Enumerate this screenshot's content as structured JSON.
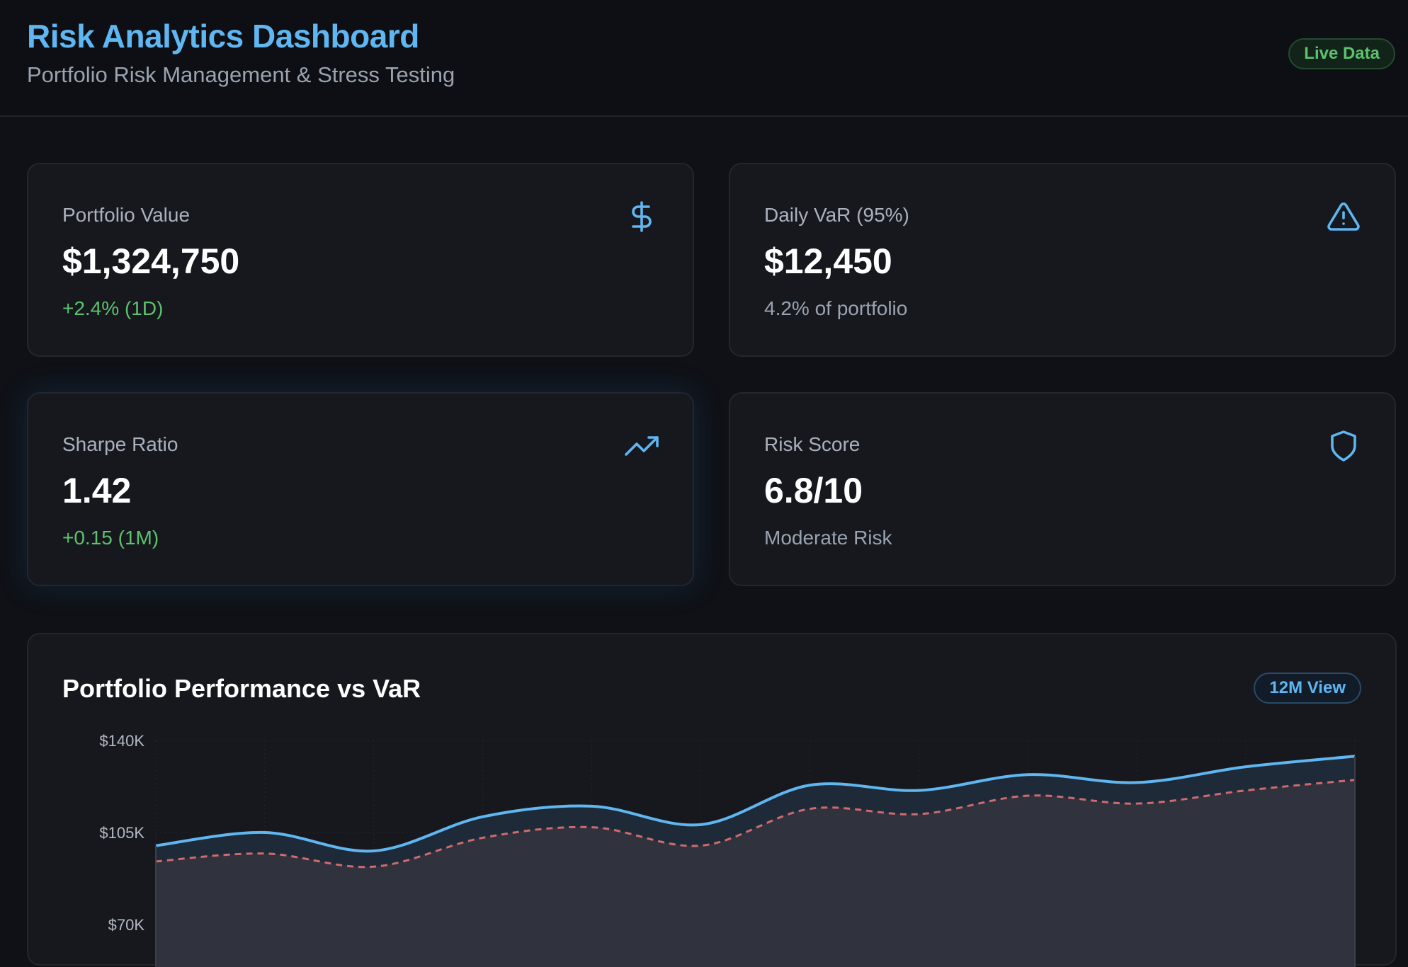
{
  "header": {
    "title": "Risk Analytics Dashboard",
    "subtitle": "Portfolio Risk Management & Stress Testing",
    "live_badge": "Live Data"
  },
  "kpis": [
    {
      "label": "Portfolio Value",
      "value": "$1,324,750",
      "sub": "+2.4% (1D)",
      "sub_color": "#5cc26d",
      "icon": "dollar-icon"
    },
    {
      "label": "Daily VaR (95%)",
      "value": "$12,450",
      "sub": "4.2% of portfolio",
      "sub_color": "#9aa3b0",
      "icon": "warning-icon"
    },
    {
      "label": "Sharpe Ratio",
      "value": "1.42",
      "sub": "+0.15 (1M)",
      "sub_color": "#5cc26d",
      "icon": "trending-up-icon"
    },
    {
      "label": "Risk Score",
      "value": "6.8/10",
      "sub": "Moderate Risk",
      "sub_color": "#9aa3b0",
      "icon": "shield-icon"
    }
  ],
  "colors": {
    "accent": "#5fb6f0",
    "positive": "#5cc26d",
    "var_line": "#d06a6e",
    "background": "#0f1116",
    "card": "#16181e"
  },
  "chart": {
    "title": "Portfolio Performance vs VaR",
    "view_badge": "12M View"
  },
  "chart_data": {
    "type": "area",
    "title": "Portfolio Performance vs VaR",
    "x_count": 12,
    "ylim": [
      70000,
      140000
    ],
    "y_ticks": [
      {
        "value": 140000,
        "label": "$140K"
      },
      {
        "value": 105000,
        "label": "$105K"
      },
      {
        "value": 70000,
        "label": "$70K"
      }
    ],
    "grid": true,
    "series": [
      {
        "key": "portfolio",
        "style": "solid",
        "color": "#5fb6f0",
        "values": [
          100000,
          105000,
          98000,
          111000,
          115000,
          108000,
          123000,
          121000,
          127000,
          124000,
          130000,
          134000
        ]
      },
      {
        "key": "var",
        "style": "dashed",
        "color": "#d06a6e",
        "values": [
          94000,
          97000,
          92000,
          103000,
          107000,
          100000,
          114000,
          112000,
          119000,
          116000,
          121000,
          125000
        ]
      }
    ]
  }
}
